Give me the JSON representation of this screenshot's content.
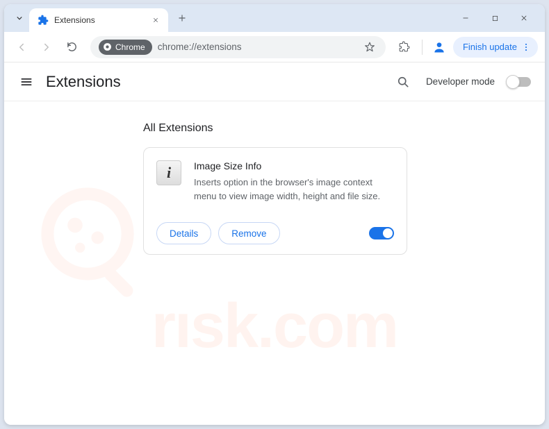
{
  "tab": {
    "title": "Extensions"
  },
  "toolbar": {
    "chrome_label": "Chrome",
    "url": "chrome://extensions",
    "finish_update": "Finish update"
  },
  "page": {
    "title": "Extensions",
    "developer_mode_label": "Developer mode",
    "section_title": "All Extensions"
  },
  "extension": {
    "name": "Image Size Info",
    "description": "Inserts option in the browser's image context menu to view image width, height and file size.",
    "details_label": "Details",
    "remove_label": "Remove",
    "icon_glyph": "i"
  },
  "watermark": "rısk.com"
}
